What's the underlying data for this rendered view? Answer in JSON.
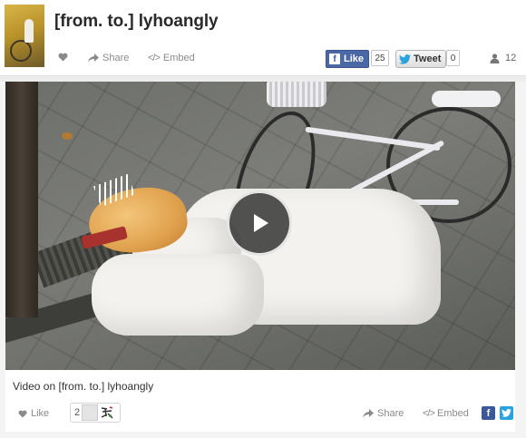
{
  "header": {
    "title": "[from. to.] lyhoangly",
    "share_label": "Share",
    "embed_label": "Embed",
    "embed_glyph": "</>",
    "facebook": {
      "label": "Like",
      "count": "25",
      "glyph": "f"
    },
    "twitter": {
      "label": "Tweet",
      "count": "0"
    },
    "user_count": "12"
  },
  "video": {
    "play_icon": "play-icon"
  },
  "footer": {
    "caption": "Video on [from. to.] lyhoangly",
    "like_label": "Like",
    "liker_count": "2",
    "share_label": "Share",
    "embed_label": "Embed",
    "embed_glyph": "</>",
    "fb_glyph": "f",
    "tw_glyph": "t"
  },
  "colors": {
    "facebook": "#4a67a6",
    "twitter": "#2aa2dd"
  }
}
